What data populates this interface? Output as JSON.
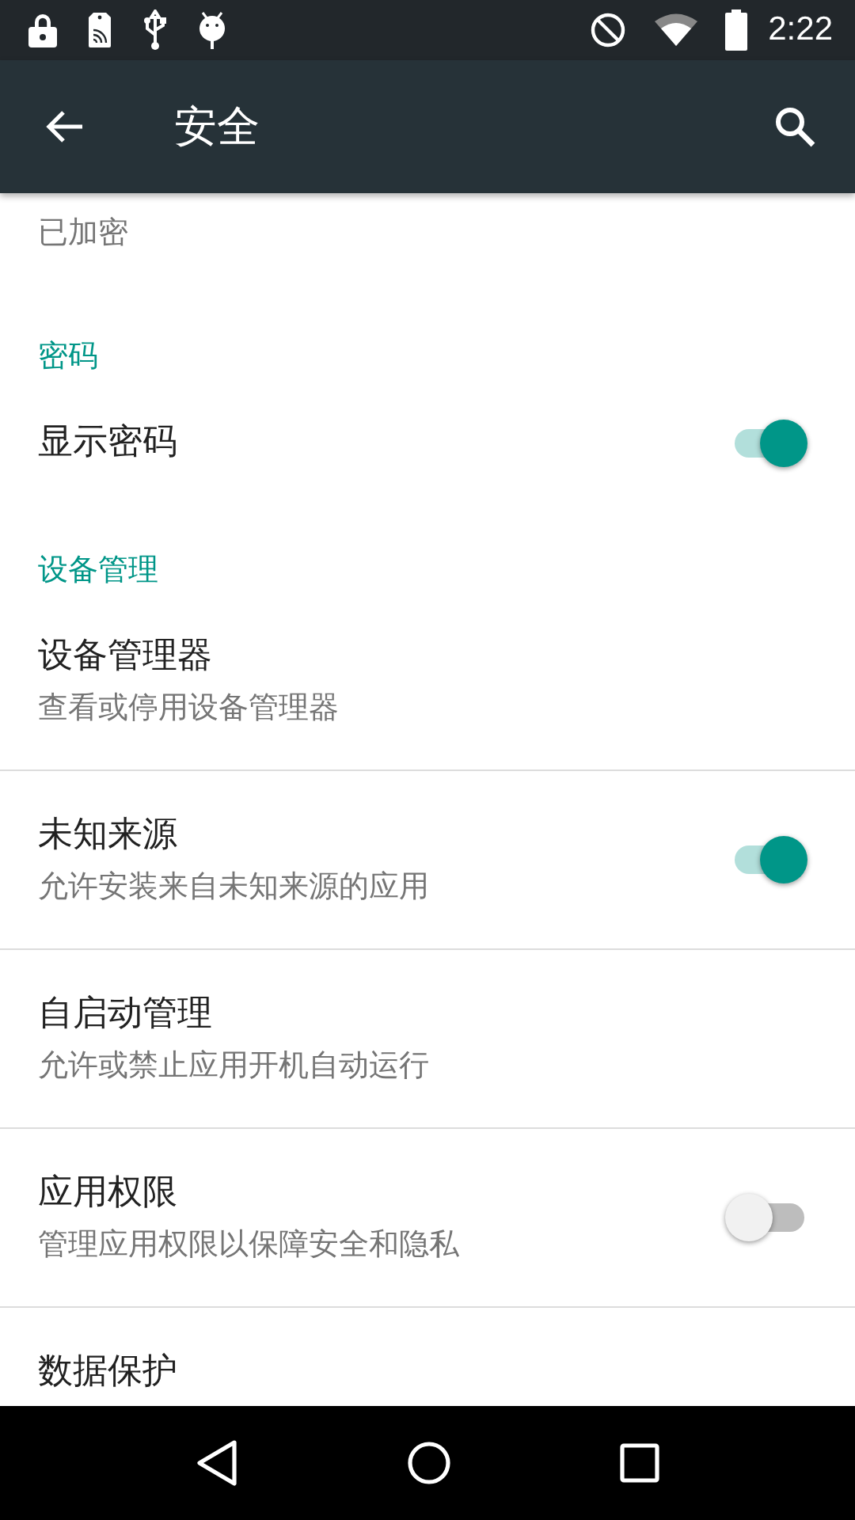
{
  "status_bar": {
    "time": "2:22"
  },
  "toolbar": {
    "title": "安全"
  },
  "sections": [
    {
      "items": [
        {
          "kind": "plain",
          "subtitle": "已加密"
        }
      ]
    },
    {
      "header": "密码",
      "items": [
        {
          "kind": "switch",
          "title": "显示密码",
          "on": true
        }
      ]
    },
    {
      "header": "设备管理",
      "items": [
        {
          "kind": "plain",
          "title": "设备管理器",
          "subtitle": "查看或停用设备管理器"
        },
        {
          "kind": "switch",
          "title": "未知来源",
          "subtitle": "允许安装来自未知来源的应用",
          "on": true
        },
        {
          "kind": "plain",
          "title": "自启动管理",
          "subtitle": "允许或禁止应用开机自动运行"
        },
        {
          "kind": "switch",
          "title": "应用权限",
          "subtitle": "管理应用权限以保障安全和隐私",
          "on": false
        },
        {
          "kind": "plain",
          "title": "数据保护"
        }
      ]
    }
  ]
}
